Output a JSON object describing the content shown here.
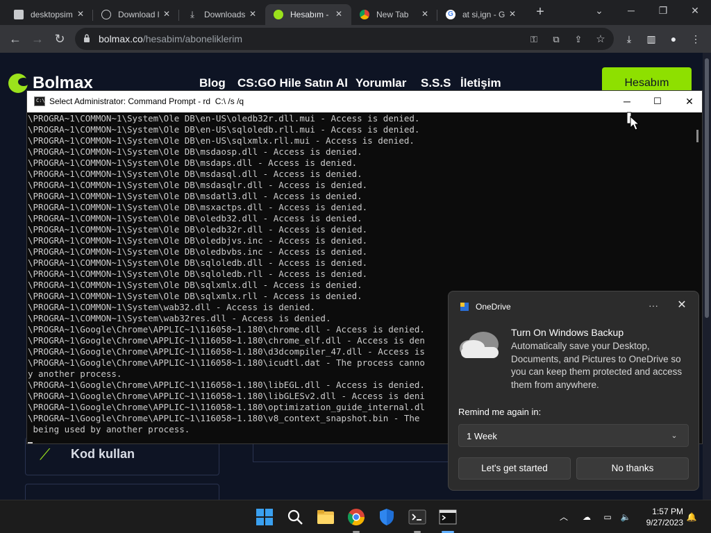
{
  "browser": {
    "tabs": [
      {
        "label": "desktopsim",
        "icon": "bookmark-icon"
      },
      {
        "label": "Download l",
        "icon": "globe-icon"
      },
      {
        "label": "Downloads",
        "icon": "download-icon"
      },
      {
        "label": "Hesabım -",
        "icon": "bolmax-icon",
        "active": true
      },
      {
        "label": "New Tab",
        "icon": "chrome-icon"
      },
      {
        "label": "at si,ign - G",
        "icon": "google-icon"
      }
    ],
    "url_domain": "bolmax.co",
    "url_path": "/hesabim/aboneliklerim"
  },
  "site": {
    "brand": "Bolmax",
    "nav": [
      "Blog",
      "CS:GO Hile Satın Al",
      "Yorumlar",
      "S.S.S",
      "İletişim"
    ],
    "account_button": "Hesabım",
    "card_label": "Kod kullan",
    "accent_color": "#8ee000"
  },
  "cmd": {
    "title": "Select Administrator: Command Prompt - rd  C:\\ /s /q",
    "lines": [
      "\\PROGRA~1\\COMMON~1\\System\\Ole DB\\en-US\\oledb32r.dll.mui - Access is denied.",
      "\\PROGRA~1\\COMMON~1\\System\\Ole DB\\en-US\\sqloledb.rll.mui - Access is denied.",
      "\\PROGRA~1\\COMMON~1\\System\\Ole DB\\en-US\\sqlxmlx.rll.mui - Access is denied.",
      "\\PROGRA~1\\COMMON~1\\System\\Ole DB\\msdaosp.dll - Access is denied.",
      "\\PROGRA~1\\COMMON~1\\System\\Ole DB\\msdaps.dll - Access is denied.",
      "\\PROGRA~1\\COMMON~1\\System\\Ole DB\\msdasql.dll - Access is denied.",
      "\\PROGRA~1\\COMMON~1\\System\\Ole DB\\msdasqlr.dll - Access is denied.",
      "\\PROGRA~1\\COMMON~1\\System\\Ole DB\\msdatl3.dll - Access is denied.",
      "\\PROGRA~1\\COMMON~1\\System\\Ole DB\\msxactps.dll - Access is denied.",
      "\\PROGRA~1\\COMMON~1\\System\\Ole DB\\oledb32.dll - Access is denied.",
      "\\PROGRA~1\\COMMON~1\\System\\Ole DB\\oledb32r.dll - Access is denied.",
      "\\PROGRA~1\\COMMON~1\\System\\Ole DB\\oledbjvs.inc - Access is denied.",
      "\\PROGRA~1\\COMMON~1\\System\\Ole DB\\oledbvbs.inc - Access is denied.",
      "\\PROGRA~1\\COMMON~1\\System\\Ole DB\\sqloledb.dll - Access is denied.",
      "\\PROGRA~1\\COMMON~1\\System\\Ole DB\\sqloledb.rll - Access is denied.",
      "\\PROGRA~1\\COMMON~1\\System\\Ole DB\\sqlxmlx.dll - Access is denied.",
      "\\PROGRA~1\\COMMON~1\\System\\Ole DB\\sqlxmlx.rll - Access is denied.",
      "\\PROGRA~1\\COMMON~1\\System\\wab32.dll - Access is denied.",
      "\\PROGRA~1\\COMMON~1\\System\\wab32res.dll - Access is denied.",
      "\\PROGRA~1\\Google\\Chrome\\APPLIC~1\\116058~1.180\\chrome.dll - Access is denied.",
      "\\PROGRA~1\\Google\\Chrome\\APPLIC~1\\116058~1.180\\chrome_elf.dll - Access is den",
      "\\PROGRA~1\\Google\\Chrome\\APPLIC~1\\116058~1.180\\d3dcompiler_47.dll - Access is",
      "\\PROGRA~1\\Google\\Chrome\\APPLIC~1\\116058~1.180\\icudtl.dat - The process canno",
      "y another process.",
      "\\PROGRA~1\\Google\\Chrome\\APPLIC~1\\116058~1.180\\libEGL.dll - Access is denied.",
      "\\PROGRA~1\\Google\\Chrome\\APPLIC~1\\116058~1.180\\libGLESv2.dll - Access is deni",
      "\\PROGRA~1\\Google\\Chrome\\APPLIC~1\\116058~1.180\\optimization_guide_internal.dl",
      "\\PROGRA~1\\Google\\Chrome\\APPLIC~1\\116058~1.180\\v8_context_snapshot.bin - The",
      " being used by another process."
    ]
  },
  "toast": {
    "app_name": "OneDrive",
    "more_label": "···",
    "title": "Turn On Windows Backup",
    "description": "Automatically save your Desktop, Documents, and Pictures to OneDrive so you can keep them protected and access them from anywhere.",
    "remind_label": "Remind me again in:",
    "remind_value": "1 Week",
    "primary_button": "Let's get started",
    "secondary_button": "No thanks"
  },
  "taskbar": {
    "time": "1:57 PM",
    "date": "9/27/2023"
  }
}
